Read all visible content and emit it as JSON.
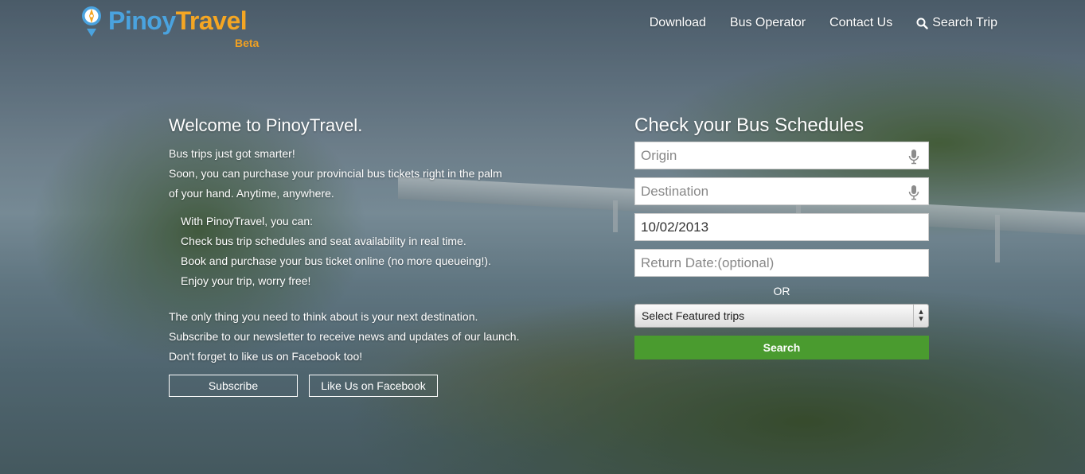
{
  "header": {
    "logo_part1": "Pinoy",
    "logo_part2": "Travel",
    "logo_badge": "Beta",
    "nav": [
      {
        "label": "Download"
      },
      {
        "label": "Bus Operator"
      },
      {
        "label": "Contact Us"
      },
      {
        "label": "Search Trip",
        "icon": "search-icon"
      }
    ]
  },
  "welcome": {
    "title": "Welcome to PinoyTravel.",
    "intro": [
      "Bus trips just got smarter!",
      "Soon, you can purchase your provincial bus tickets right in the palm",
      "of your hand. Anytime, anywhere."
    ],
    "features": [
      "With PinoyTravel, you can:",
      "Check bus trip schedules and seat availability in real time.",
      "Book and purchase your bus ticket online (no more queueing!).",
      "Enjoy your trip, worry free!"
    ],
    "closing": [
      "The only thing you need to think about is your next destination.",
      "Subscribe to our newsletter to receive news and updates of our launch.",
      "Don't forget to like us on Facebook too!"
    ],
    "subscribe_label": "Subscribe",
    "facebook_label": "Like Us on Facebook"
  },
  "search": {
    "title": "Check your Bus Schedules",
    "origin_placeholder": "Origin",
    "destination_placeholder": "Destination",
    "date_value": "10/02/2013",
    "return_placeholder": "Return Date:(optional)",
    "or_label": "OR",
    "featured_select": "Select Featured trips",
    "search_label": "Search"
  },
  "colors": {
    "logo_blue": "#4aa3df",
    "logo_orange": "#f5a623",
    "search_button": "#4a9b2f"
  }
}
